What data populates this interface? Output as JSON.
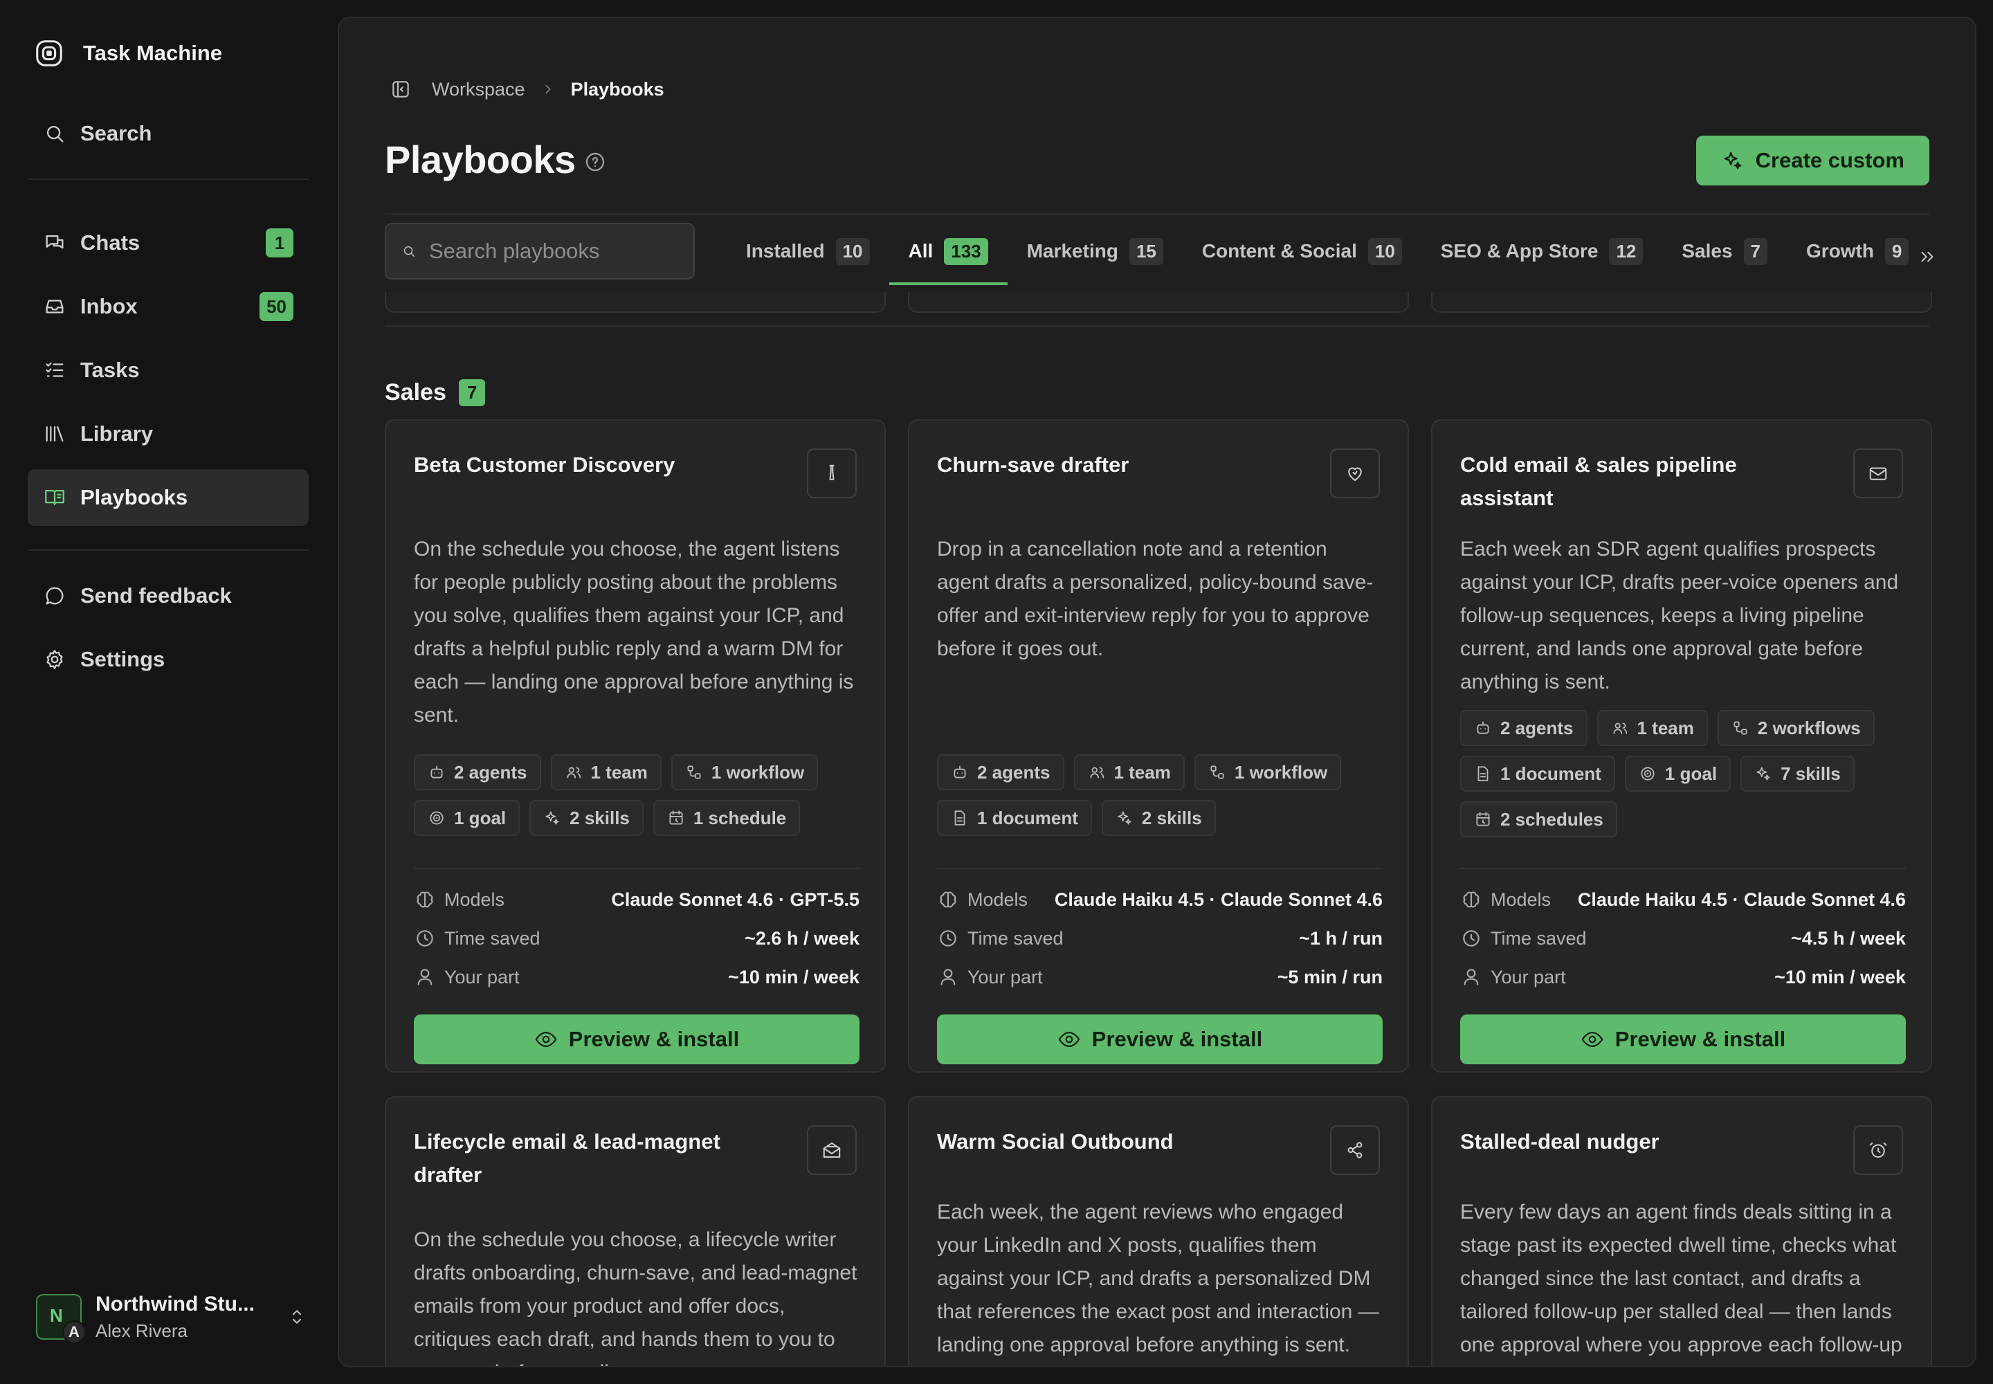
{
  "app": {
    "name": "Task Machine"
  },
  "nav": {
    "search": "Search",
    "chats": {
      "label": "Chats",
      "badge": "1"
    },
    "inbox": {
      "label": "Inbox",
      "badge": "50"
    },
    "tasks": "Tasks",
    "library": "Library",
    "playbooks": "Playbooks",
    "feedback": "Send feedback",
    "settings": "Settings"
  },
  "workspace": {
    "initial": "N",
    "user_initial": "A",
    "name": "Northwind Stu...",
    "user": "Alex Rivera"
  },
  "breadcrumb": {
    "root": "Workspace",
    "current": "Playbooks"
  },
  "page": {
    "title": "Playbooks",
    "create_label": "Create custom"
  },
  "search": {
    "placeholder": "Search playbooks",
    "value": ""
  },
  "tabs": [
    {
      "label": "Installed",
      "count": "10"
    },
    {
      "label": "All",
      "count": "133",
      "active": true
    },
    {
      "label": "Marketing",
      "count": "15"
    },
    {
      "label": "Content & Social",
      "count": "10"
    },
    {
      "label": "SEO & App Store",
      "count": "12"
    },
    {
      "label": "Sales",
      "count": "7"
    },
    {
      "label": "Growth",
      "count": "9"
    }
  ],
  "section": {
    "title": "Sales",
    "count": "7"
  },
  "labels": {
    "models": "Models",
    "time_saved": "Time saved",
    "your_part": "Your part",
    "install": "Preview & install"
  },
  "cards": [
    {
      "title": "Beta Customer Discovery",
      "icon": "flask-icon",
      "description": "On the schedule you choose, the agent listens for people publicly posting about the problems you solve, qualifies them against your ICP, and drafts a helpful public reply and a warm DM for each — landing one approval before anything is sent.",
      "chips": [
        {
          "icon": "bot",
          "label": "2 agents"
        },
        {
          "icon": "team",
          "label": "1 team"
        },
        {
          "icon": "workflow",
          "label": "1 workflow"
        },
        {
          "icon": "goal",
          "label": "1 goal"
        },
        {
          "icon": "skills",
          "label": "2 skills"
        },
        {
          "icon": "schedule",
          "label": "1 schedule"
        }
      ],
      "models": "Claude Sonnet 4.6 · GPT-5.5",
      "time_saved": "~2.6 h / week",
      "your_part": "~10 min / week"
    },
    {
      "title": "Churn-save drafter",
      "icon": "heart-icon",
      "description": "Drop in a cancellation note and a retention agent drafts a personalized, policy-bound save-offer and exit-interview reply for you to approve before it goes out.",
      "chips": [
        {
          "icon": "bot",
          "label": "2 agents"
        },
        {
          "icon": "team",
          "label": "1 team"
        },
        {
          "icon": "workflow",
          "label": "1 workflow"
        },
        {
          "icon": "document",
          "label": "1 document"
        },
        {
          "icon": "skills",
          "label": "2 skills"
        }
      ],
      "models": "Claude Haiku 4.5 · Claude Sonnet 4.6",
      "time_saved": "~1 h / run",
      "your_part": "~5 min / run"
    },
    {
      "title": "Cold email & sales pipeline assistant",
      "icon": "mail-icon",
      "description": "Each week an SDR agent qualifies prospects against your ICP, drafts peer-voice openers and follow-up sequences, keeps a living pipeline current, and lands one approval gate before anything is sent.",
      "chips": [
        {
          "icon": "bot",
          "label": "2 agents"
        },
        {
          "icon": "team",
          "label": "1 team"
        },
        {
          "icon": "workflow",
          "label": "2 workflows"
        },
        {
          "icon": "document",
          "label": "1 document"
        },
        {
          "icon": "goal",
          "label": "1 goal"
        },
        {
          "icon": "skills",
          "label": "7 skills"
        },
        {
          "icon": "schedule",
          "label": "2 schedules"
        }
      ],
      "models": "Claude Haiku 4.5 · Claude Sonnet 4.6",
      "time_saved": "~4.5 h / week",
      "your_part": "~10 min / week"
    },
    {
      "title": "Lifecycle email & lead-magnet drafter",
      "icon": "mail-open-icon",
      "description": "On the schedule you choose, a lifecycle writer drafts onboarding, churn-save, and lead-magnet emails from your product and offer docs, critiques each draft, and hands them to you to approve before sending."
    },
    {
      "title": "Warm Social Outbound",
      "icon": "share-icon",
      "description": "Each week, the agent reviews who engaged your LinkedIn and X posts, qualifies them against your ICP, and drafts a personalized DM that references the exact post and interaction — landing one approval before anything is sent."
    },
    {
      "title": "Stalled-deal nudger",
      "icon": "alarm-icon",
      "description": "Every few days an agent finds deals sitting in a stage past its expected dwell time, checks what changed since the last contact, and drafts a tailored follow-up per stalled deal — then lands one approval where you approve each follow-up before it is sent."
    }
  ]
}
